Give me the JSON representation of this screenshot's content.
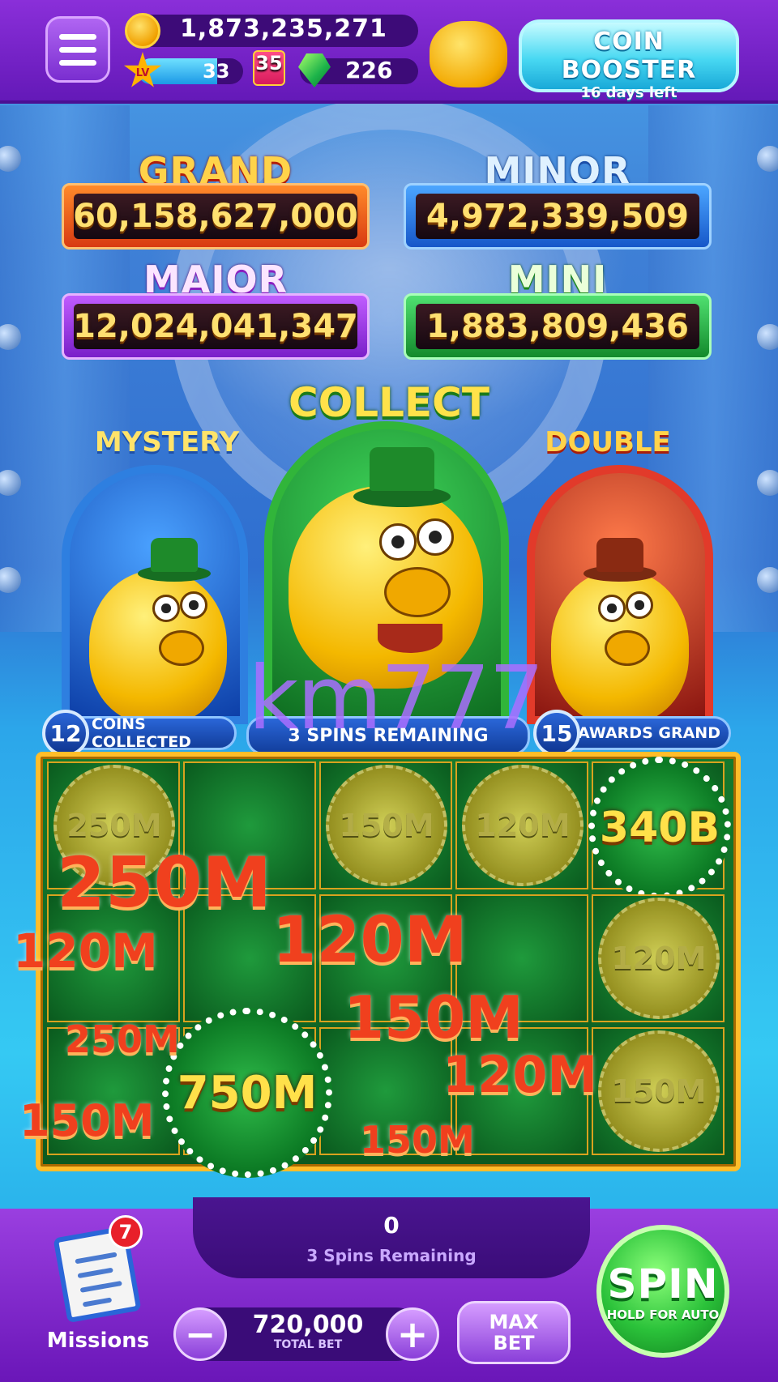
{
  "header": {
    "coins": "1,873,235,271",
    "level_badge": "LV",
    "level": "33",
    "xp_progress": 0.75,
    "gift_count": "35",
    "gems": "226",
    "booster_title": "COIN BOOSTER",
    "booster_subtitle": "16 days left"
  },
  "jackpots": {
    "grand": {
      "label": "GRAND",
      "value": "60,158,627,000"
    },
    "minor": {
      "label": "MINOR",
      "value": "4,972,339,509"
    },
    "major": {
      "label": "MAJOR",
      "value": "12,024,041,347"
    },
    "mini": {
      "label": "MINI",
      "value": "1,883,809,436"
    }
  },
  "features": {
    "mystery": "MYSTERY",
    "collect": "COLLECT",
    "double": "DOUBLE"
  },
  "status": {
    "coins_collected_count": "12",
    "coins_collected_label": "COINS COLLECTED",
    "spins_remaining_label": "3 SPINS REMAINING",
    "awards_grand_count": "15",
    "awards_grand_label": "AWARDS GRAND"
  },
  "watermark": "km777",
  "grid": {
    "r1c1": "250M",
    "r1c3": "150M",
    "r1c4": "120M",
    "r1c5": "340B",
    "r2c5": "120M",
    "r3c5": "150M",
    "center_chip": "750M"
  },
  "floating_awards": [
    "250M",
    "120M",
    "120M",
    "150M",
    "250M",
    "120M",
    "150M",
    "150M"
  ],
  "bottom": {
    "win_amount": "0",
    "spins_remaining": "3 Spins Remaining",
    "missions_badge": "7",
    "missions_label": "Missions",
    "total_bet": "720,000",
    "total_bet_label": "TOTAL BET",
    "minus": "−",
    "plus": "+",
    "max_bet_line1": "MAX",
    "max_bet_line2": "BET",
    "spin_label": "SPIN",
    "spin_sub": "HOLD FOR AUTO"
  }
}
